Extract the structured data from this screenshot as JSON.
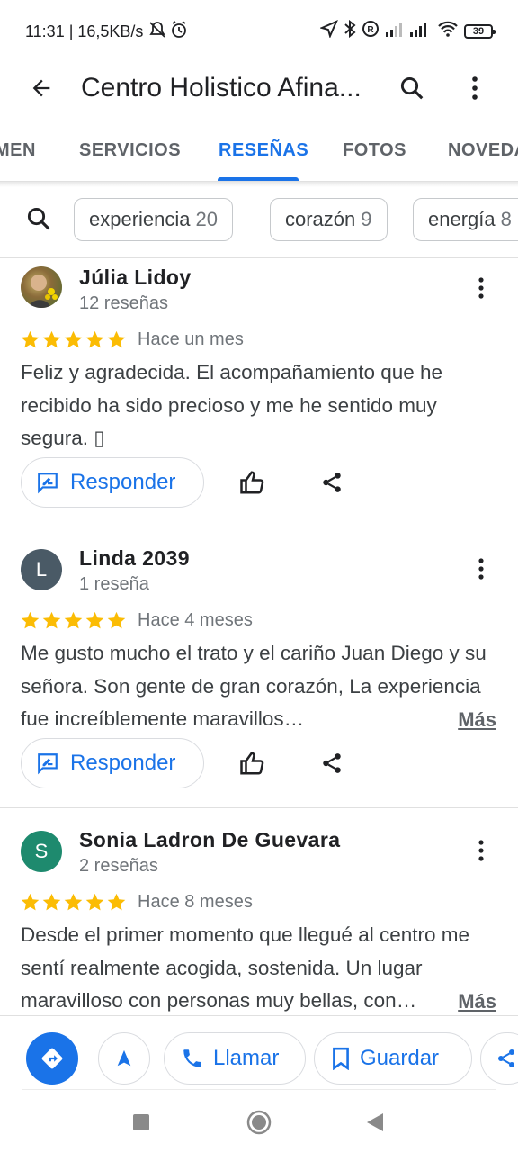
{
  "status": {
    "time_speed": "11:31 | 16,5KB/s",
    "battery": "39"
  },
  "appbar": {
    "title": "Centro Holistico Afina..."
  },
  "tabs": [
    {
      "label": "MEN"
    },
    {
      "label": "SERVICIOS"
    },
    {
      "label": "RESEÑAS",
      "active": true
    },
    {
      "label": "FOTOS"
    },
    {
      "label": "NOVEDA"
    }
  ],
  "chips": [
    {
      "label": "experiencia",
      "count": "20"
    },
    {
      "label": "corazón",
      "count": "9"
    },
    {
      "label": "energía",
      "count": "8"
    }
  ],
  "reviews": [
    {
      "name": "Júlia Lidoy",
      "count": "12 reseñas",
      "rating": 5,
      "date": "Hace un mes",
      "text": "Feliz y agradecida. El acompañamiento que he recibido ha sido precioso y me he sentido muy segura. ▯",
      "more": "",
      "avatar_initial": "",
      "avatar_color": "#6b8e23"
    },
    {
      "name": "Linda 2039",
      "count": "1 reseña",
      "rating": 5,
      "date": "Hace 4 meses",
      "text": "Me gusto mucho el trato y el cariño Juan Diego y su señora. Son gente de gran corazón, La experiencia fue increíblemente maravillos…",
      "more": "Más",
      "avatar_initial": "L",
      "avatar_color": "#4a5a66"
    },
    {
      "name": "Sonia Ladron De Guevara",
      "count": "2 reseñas",
      "rating": 5,
      "date": "Hace 8 meses",
      "text": "Desde el primer momento que llegué al centro me sentí realmente acogida, sostenida. Un lugar maravilloso con personas muy bellas, con…",
      "more": "Más",
      "avatar_initial": "S",
      "avatar_color": "#1e8a6e"
    }
  ],
  "actions": {
    "reply_label": "Responder"
  },
  "bottom": {
    "call_label": "Llamar",
    "save_label": "Guardar"
  },
  "colors": {
    "accent": "#1a73e8",
    "star": "#fbbc04"
  }
}
